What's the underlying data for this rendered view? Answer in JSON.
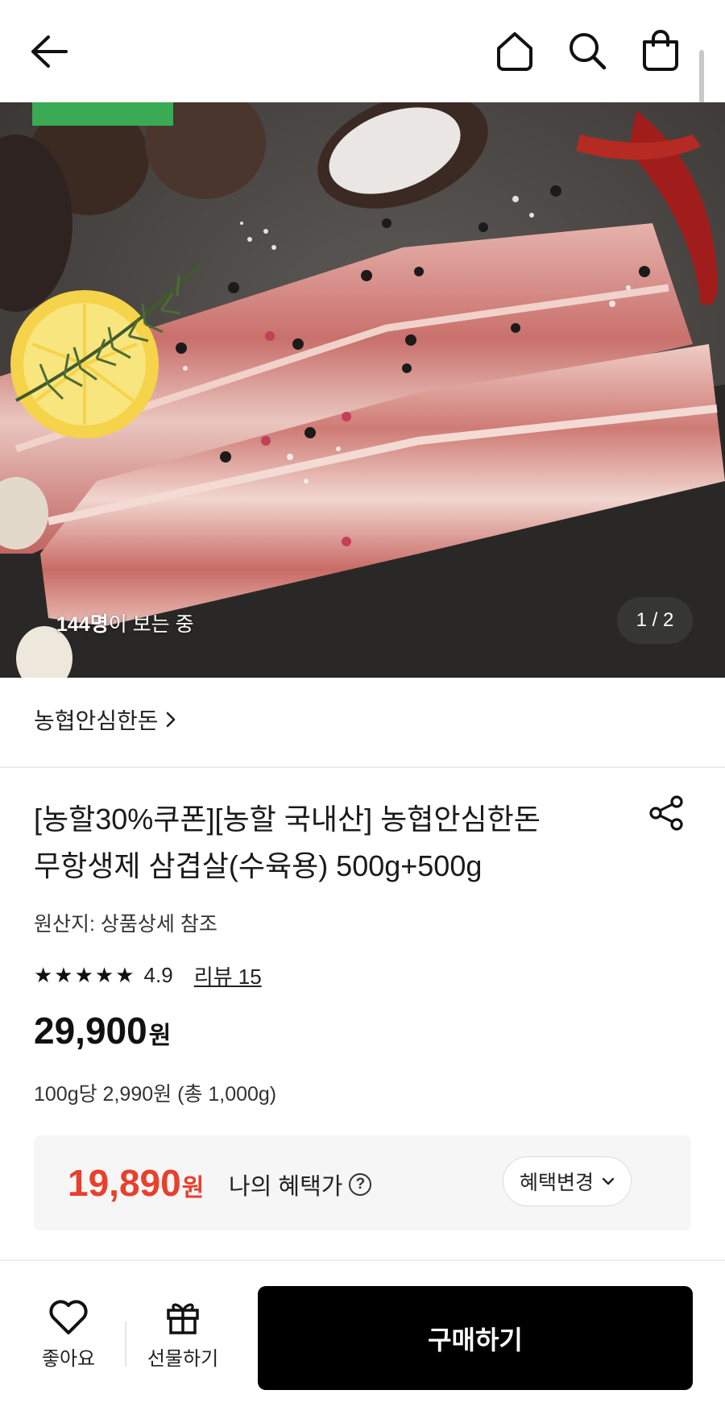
{
  "header": {
    "icons": [
      "back-arrow-icon",
      "home-icon",
      "search-icon",
      "shopping-bag-icon"
    ]
  },
  "hero": {
    "viewers_count": "144명",
    "viewers_suffix": "이 보는 중",
    "pager": "1 / 2",
    "badge_color": "#3aaa55"
  },
  "product": {
    "brand": "농협안심한돈",
    "title_line1": "[농할30%쿠폰][농할 국내산] 농협안심한돈",
    "title_line2": "무항생제 삼겹살(수육용) 500g+500g",
    "origin": "원산지: 상품상세 참조",
    "stars": "★★★★★",
    "rating": "4.9",
    "review": "리뷰 15",
    "price": "29,900",
    "price_unit": "원",
    "unit_price": "100g당 2,990원 (총 1,000g)"
  },
  "benefit": {
    "price": "19,890",
    "price_unit": "원",
    "label": "나의 혜택가",
    "help": "?",
    "change_button": "혜택변경",
    "accent": "#e8402c"
  },
  "bottom_bar": {
    "like": "좋아요",
    "gift": "선물하기",
    "buy": "구매하기"
  }
}
